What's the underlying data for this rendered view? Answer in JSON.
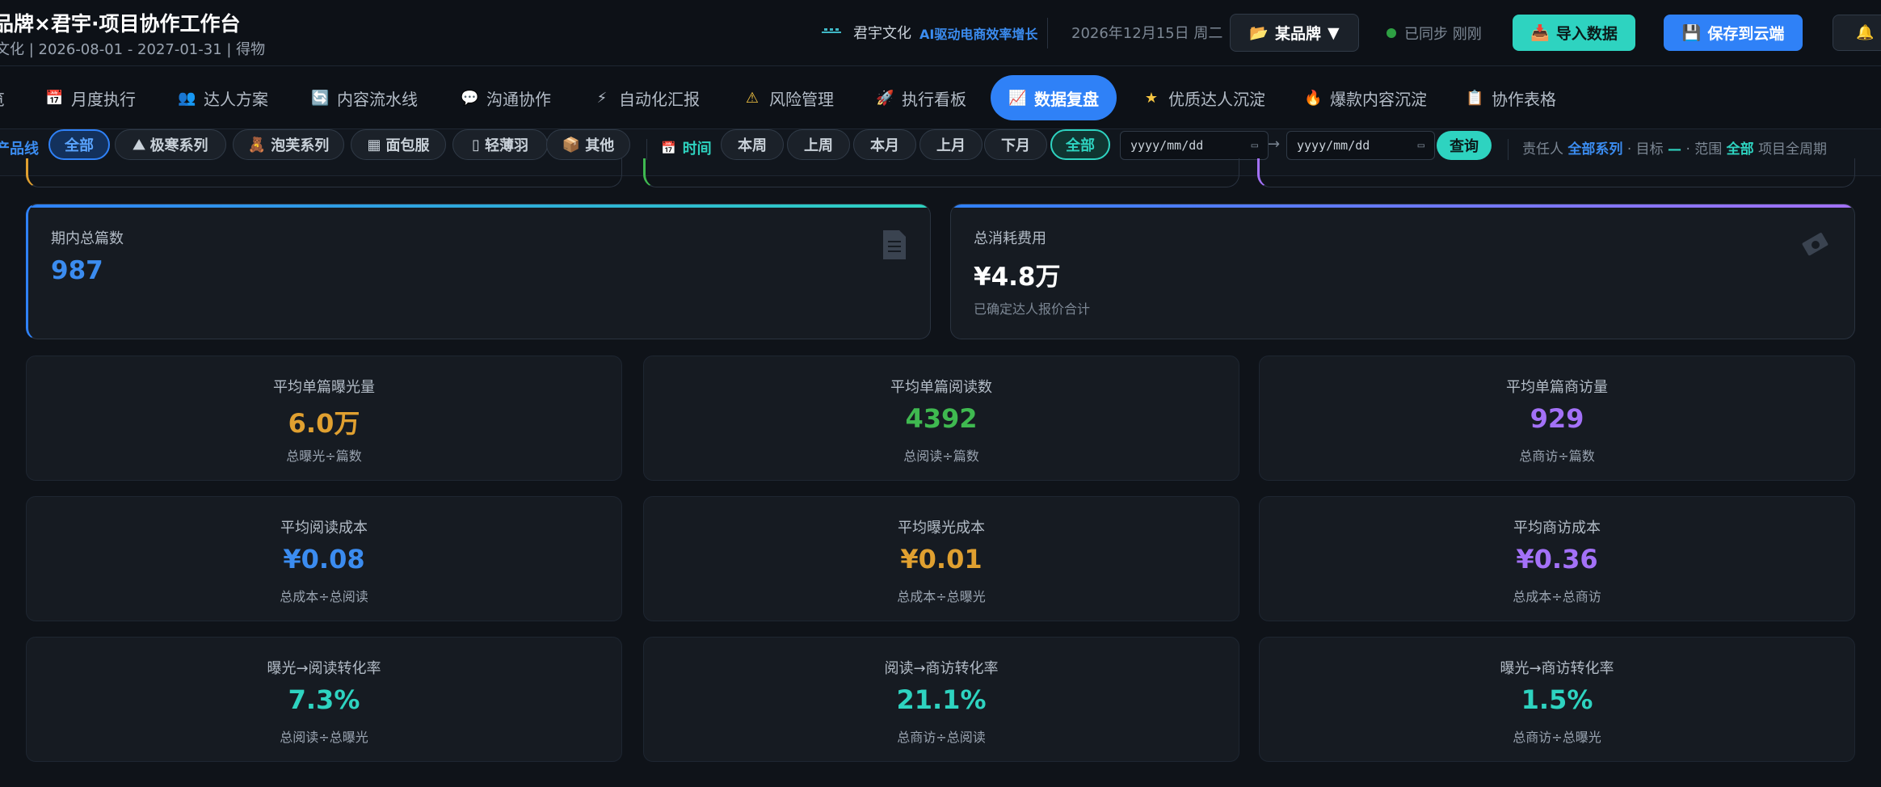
{
  "header": {
    "title": "品牌×君宇·项目协作工作台",
    "subtitle": "文化 | 2026-08-01 - 2027-01-31 | 得物",
    "brand_name": "君宇文化",
    "brand_slogan": "AI驱动电商效率增长",
    "date": "2026年12月15日 周二",
    "brand_select": "某品牌",
    "sync_status": "已同步 刚刚",
    "import_label": "导入数据",
    "save_label": "保存到云端"
  },
  "nav": {
    "tabs": [
      {
        "icon": "📅",
        "label": "月度执行"
      },
      {
        "icon": "👥",
        "label": "达人方案"
      },
      {
        "icon": "🔄",
        "label": "内容流水线"
      },
      {
        "icon": "💬",
        "label": "沟通协作"
      },
      {
        "icon": "⚡",
        "label": "自动化汇报"
      },
      {
        "icon": "⚠",
        "label": "风险管理"
      },
      {
        "icon": "🚀",
        "label": "执行看板"
      },
      {
        "icon": "📈",
        "label": "数据复盘"
      },
      {
        "icon": "★",
        "label": "优质达人沉淀"
      },
      {
        "icon": "🔥",
        "label": "爆款内容沉淀"
      },
      {
        "icon": "📋",
        "label": "协作表格"
      }
    ],
    "active_index": 7
  },
  "filters": {
    "product_label": "产品线",
    "products": [
      {
        "icon": "",
        "label": "全部"
      },
      {
        "icon": "⛰",
        "label": "极寒系列"
      },
      {
        "icon": "🧸",
        "label": "泡芙系列"
      },
      {
        "icon": "▦",
        "label": "面包服"
      },
      {
        "icon": "▯",
        "label": "轻薄羽"
      },
      {
        "icon": "📦",
        "label": "其他"
      }
    ],
    "time_label": "时间",
    "times": [
      "本周",
      "上周",
      "本月",
      "上月",
      "下月",
      "全部"
    ],
    "date_from_placeholder": "yyyy/mm/dd",
    "date_to_placeholder": "yyyy/mm/dd",
    "arrow": "→",
    "query_label": "查询",
    "meta": {
      "owner_key": "责任人",
      "owner_val": "全部系列",
      "target_key": "目标",
      "target_val": "—",
      "scope_key": "范围",
      "scope_val": "全部",
      "period": "项目全周期"
    }
  },
  "cards": {
    "total_posts": {
      "label": "期内总篇数",
      "value": "987",
      "icon": "document-icon"
    },
    "total_cost": {
      "label": "总消耗费用",
      "value": "¥4.8万",
      "note": "已确定达人报价合计",
      "icon": "money-icon"
    }
  },
  "metrics": [
    {
      "label": "平均单篇曝光量",
      "value": "6.0万",
      "note": "总曝光÷篇数",
      "color": "#e0a030"
    },
    {
      "label": "平均单篇阅读数",
      "value": "4392",
      "note": "总阅读÷篇数",
      "color": "#3fb950"
    },
    {
      "label": "平均单篇商访量",
      "value": "929",
      "note": "总商访÷篇数",
      "color": "#a371f7"
    },
    {
      "label": "平均阅读成本",
      "value": "¥0.08",
      "note": "总成本÷总阅读",
      "color": "#3b8cf0"
    },
    {
      "label": "平均曝光成本",
      "value": "¥0.01",
      "note": "总成本÷总曝光",
      "color": "#e0a030"
    },
    {
      "label": "平均商访成本",
      "value": "¥0.36",
      "note": "总成本÷总商访",
      "color": "#a371f7"
    },
    {
      "label": "曝光→阅读转化率",
      "value": "7.3%",
      "note": "总阅读÷总曝光",
      "color": "#2ed3c0"
    },
    {
      "label": "阅读→商访转化率",
      "value": "21.1%",
      "note": "总商访÷总阅读",
      "color": "#2ed3c0"
    },
    {
      "label": "曝光→商访转化率",
      "value": "1.5%",
      "note": "总商访÷总曝光",
      "color": "#2ed3c0"
    }
  ]
}
